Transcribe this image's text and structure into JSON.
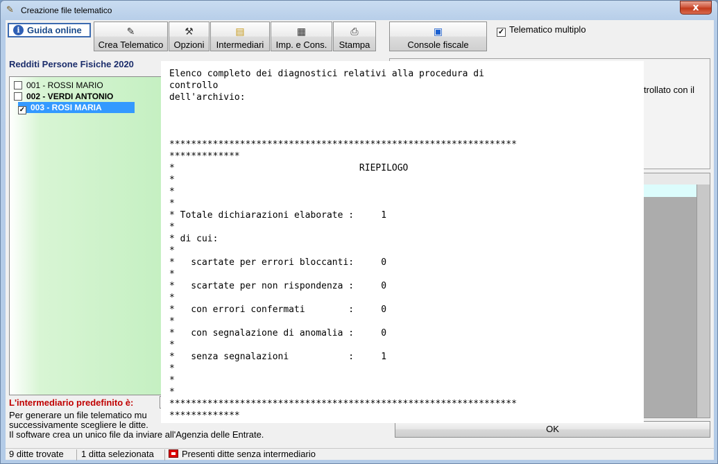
{
  "window": {
    "title": "Creazione file telematico",
    "close_label": "x"
  },
  "toolbar": {
    "guida_label": "Guida online",
    "buttons": [
      {
        "label": "Crea Telematico",
        "icon": "wizard-icon"
      },
      {
        "label": "Opzioni",
        "icon": "wrench-icon"
      },
      {
        "label": "Intermediari",
        "icon": "folder-icon"
      },
      {
        "label": "Imp. e Cons.",
        "icon": "import-export-icon"
      },
      {
        "label": "Stampa",
        "icon": "printer-icon"
      }
    ],
    "console_label": "Console fiscale",
    "telematico_multiplo_label": "Telematico multiplo",
    "telematico_multiplo_checked": true
  },
  "list": {
    "title": "Redditi Persone Fisiche 2020",
    "items": [
      {
        "label": "001 - ROSSI MARIO",
        "checked": false,
        "selected": false,
        "bold": false
      },
      {
        "label": "002 - VERDI ANTONIO",
        "checked": false,
        "selected": false,
        "bold": true
      },
      {
        "label": "003 - ROSI MARIA",
        "checked": true,
        "selected": true,
        "bold": true
      }
    ]
  },
  "intermediario": {
    "label": "L'intermediario predefinito è:"
  },
  "info": {
    "line1": "Per generare un file telematico mu",
    "line2": "successivamente scegliere le ditte.",
    "line3": "Il software crea un unico file da inviare all'Agenzia delle Entrate."
  },
  "right_panel": {
    "partial_text": "trollato con il"
  },
  "ok_button": "OK",
  "status": {
    "found": "9 ditte trovate",
    "selected": "1 ditta selezionata",
    "warning": "Presenti ditte senza intermediario"
  },
  "diagnostics": {
    "text": "Elenco completo dei diagnostici relativi alla procedura di\ncontrollo\ndell'archivio:\n\n\n\n****************************************************************\n*************\n*                                  RIEPILOGO\n*\n*\n*\n* Totale dichiarazioni elaborate :     1\n*\n* di cui:\n*\n*   scartate per errori bloccanti:     0\n*\n*   scartate per non rispondenza :     0\n*\n*   con errori confermati        :     0\n*\n*   con segnalazione di anomalia :     0\n*\n*   senza segnalazioni           :     1\n*\n*\n*\n****************************************************************\n*************"
  }
}
